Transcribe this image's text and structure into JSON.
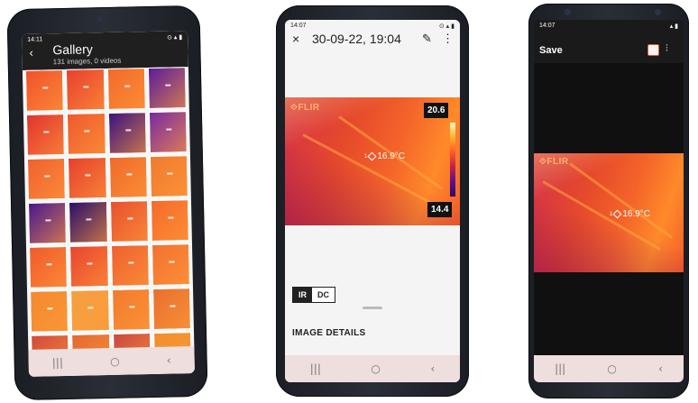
{
  "phone1": {
    "status_time": "14:11",
    "status_icons": "⊙ ▴ ▮",
    "back_icon": "back-arrow-icon",
    "back_glyph": "‹",
    "title": "Gallery",
    "subtitle": "131 images, 0 videos",
    "thumbnails": [
      "#f0522c",
      "#e8402e",
      "#f26a2a",
      "#5a1c9a",
      "#e2332f",
      "#ef5a2d",
      "#3a1280",
      "#7a2aa0",
      "#f06030",
      "#e6402e",
      "#ee6a2c",
      "#f07a30",
      "#4a168e",
      "#2a0e6a",
      "#e85030",
      "#f56a2c",
      "#f05a2c",
      "#e84430",
      "#ee6030",
      "#f27230",
      "#f38a2e",
      "#f4a040",
      "#f27a2e",
      "#e8702e",
      "#d24a3a",
      "#e26a30",
      "#c84a40",
      "#f0902c"
    ],
    "nav": [
      "|||",
      "○",
      "‹"
    ]
  },
  "phone2": {
    "status_time": "14:07",
    "status_icons": "⊙ ▴ ▮",
    "close_glyph": "×",
    "date": "30-09-22, 19:04",
    "edit_glyph": "✎",
    "more_glyph": "⋮",
    "flir_logo": "⟐FLIR",
    "spot_index": "1",
    "spot_temp": "16.9°C",
    "scale_max": "20.6",
    "scale_min": "14.4",
    "ir_label": "IR",
    "dc_label": "DC",
    "details_label": "IMAGE DETAILS",
    "nav": [
      "|||",
      "○",
      "‹"
    ]
  },
  "phone3": {
    "status_time": "14:07",
    "status_icons": "▴ ▮",
    "save_label": "Save",
    "adjust_glyph": "⫶",
    "flir_logo": "⟐FLIR",
    "spot_index": "1",
    "spot_temp": "16.9°C",
    "nav": [
      "|||",
      "○",
      "‹"
    ]
  },
  "colors": {
    "thermal_hot": "#ff8a2a",
    "thermal_mid": "#e64a2b",
    "thermal_cold": "#3a1280",
    "nav_bg": "#efdede"
  }
}
